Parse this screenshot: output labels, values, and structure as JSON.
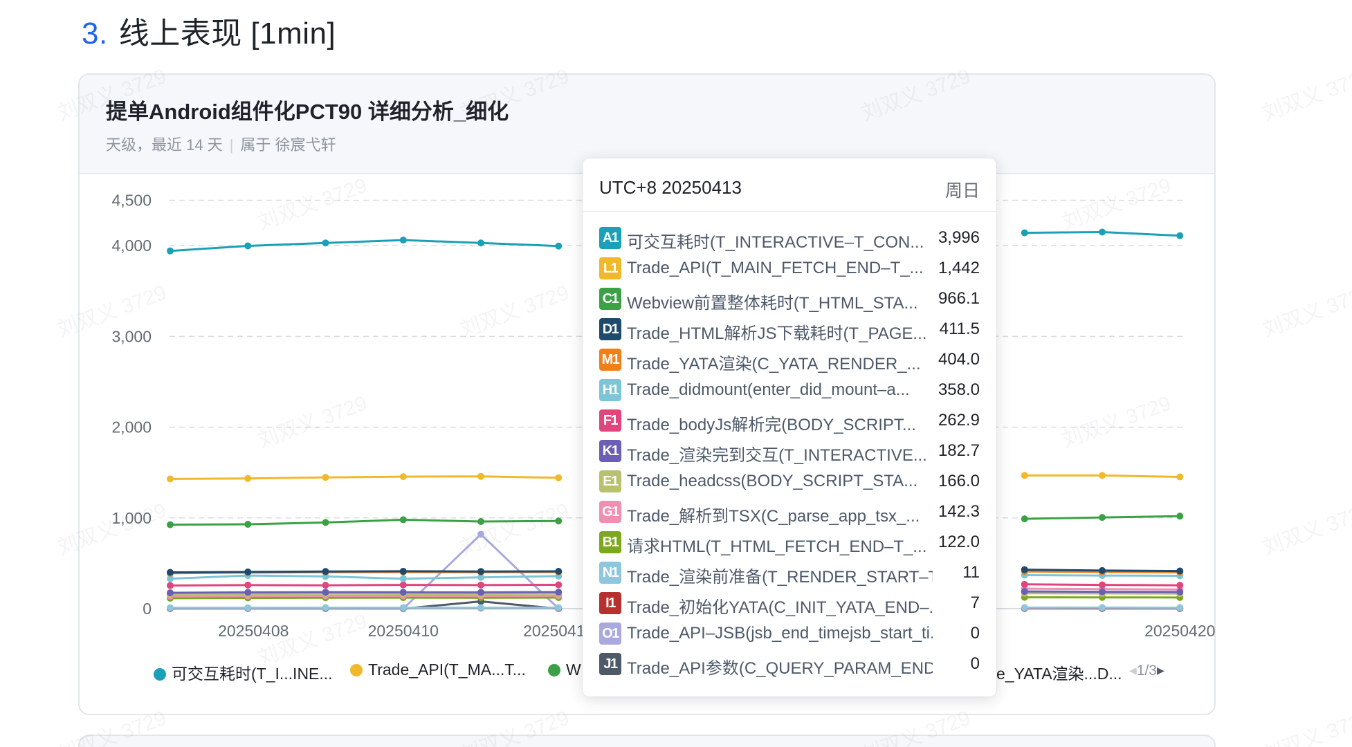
{
  "section": {
    "number": "3.",
    "title": "线上表现 [1min]"
  },
  "card": {
    "title": "提单Android组件化PCT90 详细分析_细化",
    "subtitle_granularity": "天级，最近 14 天",
    "subtitle_owner": "属于 徐宸弋轩"
  },
  "watermark": "刘双义 3729",
  "legend": {
    "visible_items": [
      {
        "label": "可交互耗时(T_I...INE...",
        "color": "#1aa0b8"
      },
      {
        "label": "Trade_API(T_MA...T...",
        "color": "#f2b82c"
      },
      {
        "label": "W",
        "color": "#3aa145"
      },
      {
        "label": "e_YATA渲染...D...",
        "color": "#f07f1a"
      }
    ],
    "page": "1/3"
  },
  "tooltip": {
    "time": "UTC+8 20250413",
    "day": "周日",
    "rows": [
      {
        "badge": "A1",
        "color": "#1aa0b8",
        "name": "可交互耗时(T_INTERACTIVE–T_CON...",
        "value": "3,996"
      },
      {
        "badge": "L1",
        "color": "#f2b82c",
        "name": "Trade_API(T_MAIN_FETCH_END–T_...",
        "value": "1,442"
      },
      {
        "badge": "C1",
        "color": "#3aa145",
        "name": "Webview前置整体耗时(T_HTML_STA...",
        "value": "966.1"
      },
      {
        "badge": "D1",
        "color": "#1e4a6e",
        "name": "Trade_HTML解析JS下载耗时(T_PAGE...",
        "value": "411.5"
      },
      {
        "badge": "M1",
        "color": "#f07f1a",
        "name": "Trade_YATA渲染(C_YATA_RENDER_...",
        "value": "404.0"
      },
      {
        "badge": "H1",
        "color": "#7cc5d6",
        "name": "Trade_didmount(enter_did_mount–a...",
        "value": "358.0"
      },
      {
        "badge": "F1",
        "color": "#e0457b",
        "name": "Trade_bodyJs解析完(BODY_SCRIPT...",
        "value": "262.9"
      },
      {
        "badge": "K1",
        "color": "#6b5fb5",
        "name": "Trade_渲染完到交互(T_INTERACTIVE...",
        "value": "182.7"
      },
      {
        "badge": "E1",
        "color": "#b7c16e",
        "name": "Trade_headcss(BODY_SCRIPT_STA...",
        "value": "166.0"
      },
      {
        "badge": "G1",
        "color": "#f08fb0",
        "name": "Trade_解析到TSX(C_parse_app_tsx_...",
        "value": "142.3"
      },
      {
        "badge": "B1",
        "color": "#7ba81e",
        "name": "请求HTML(T_HTML_FETCH_END–T_...",
        "value": "122.0"
      },
      {
        "badge": "N1",
        "color": "#8ec6dd",
        "name": "Trade_渲染前准备(T_RENDER_START–T...",
        "value": "11"
      },
      {
        "badge": "I1",
        "color": "#b72f2f",
        "name": "Trade_初始化YATA(C_INIT_YATA_END–...",
        "value": "7"
      },
      {
        "badge": "O1",
        "color": "#a9a9e0",
        "name": "Trade_API–JSB(jsb_end_timejsb_start_ti...",
        "value": "0"
      },
      {
        "badge": "J1",
        "color": "#4e5969",
        "name": "Trade_API参数(C_QUERY_PARAM_END–...",
        "value": "0"
      }
    ]
  },
  "chart_data": {
    "type": "line",
    "x": [
      "20250407",
      "20250408",
      "20250409",
      "20250410",
      "20250411",
      "20250412",
      "20250413",
      "20250414",
      "20250415",
      "20250416",
      "20250417",
      "20250418",
      "20250419",
      "20250420"
    ],
    "x_tick_labels": [
      "20250408",
      "20250410",
      "20250412",
      "20250420"
    ],
    "y_ticks": [
      0,
      1000,
      2000,
      3000,
      4000,
      4500
    ],
    "y_tick_labels": [
      "0",
      "1,000",
      "2,000",
      "3,000",
      "4,000",
      "4,500"
    ],
    "ylim": [
      0,
      4500
    ],
    "grid": true,
    "legend_position": "bottom",
    "series": [
      {
        "name": "可交互耗时(T_INTERACTIVE–T_CON...",
        "color": "#1aa0b8",
        "values": [
          3942,
          3998,
          4030,
          4062,
          4030,
          3996,
          null,
          null,
          null,
          null,
          null,
          4142,
          4150,
          4110
        ]
      },
      {
        "name": "Trade_API(T_MAIN_FETCH_END–T_...",
        "color": "#f2b82c",
        "values": [
          1430,
          1435,
          1447,
          1455,
          1458,
          1442,
          null,
          null,
          null,
          null,
          null,
          1468,
          1468,
          1452
        ]
      },
      {
        "name": "Webview前置整体耗时(T_HTML_STA...",
        "color": "#3aa145",
        "values": [
          925,
          930,
          950,
          980,
          960,
          966.1,
          null,
          null,
          null,
          null,
          null,
          990,
          1005,
          1020
        ]
      },
      {
        "name": "Trade_HTML解析JS下载耗时(T_PAGE...",
        "color": "#1e4a6e",
        "values": [
          400,
          405,
          410,
          412,
          410,
          411.5,
          null,
          null,
          null,
          null,
          null,
          430,
          420,
          415
        ]
      },
      {
        "name": "Trade_YATA渲染(C_YATA_RENDER_...",
        "color": "#f07f1a",
        "values": [
          390,
          398,
          402,
          403,
          402,
          404,
          null,
          null,
          null,
          null,
          null,
          410,
          405,
          402
        ]
      },
      {
        "name": "Trade_didmount(enter_did_mount–a...",
        "color": "#7cc5d6",
        "values": [
          330,
          365,
          355,
          330,
          345,
          358,
          null,
          null,
          null,
          null,
          null,
          370,
          365,
          362
        ]
      },
      {
        "name": "Trade_bodyJs解析完(BODY_SCRIPT...",
        "color": "#e0457b",
        "values": [
          255,
          260,
          258,
          262,
          260,
          262.9,
          null,
          null,
          null,
          null,
          null,
          268,
          262,
          258
        ]
      },
      {
        "name": "Trade_渲染完到交互(T_INTERACTIVE...",
        "color": "#6b5fb5",
        "values": [
          175,
          180,
          182,
          181,
          180,
          182.7,
          null,
          null,
          null,
          null,
          null,
          190,
          186,
          184
        ]
      },
      {
        "name": "Trade_headcss(BODY_SCRIPT_STA...",
        "color": "#b7c16e",
        "values": [
          160,
          163,
          165,
          164,
          164,
          166,
          null,
          null,
          null,
          null,
          null,
          170,
          168,
          166
        ]
      },
      {
        "name": "Trade_解析到TSX(C_parse_app_tsx_...",
        "color": "#f08fb0",
        "values": [
          138,
          140,
          141,
          142,
          141,
          142.3,
          null,
          null,
          null,
          null,
          null,
          220,
          215,
          212
        ]
      },
      {
        "name": "请求HTML(T_HTML_FETCH_END–T_...",
        "color": "#7ba81e",
        "values": [
          115,
          118,
          120,
          121,
          120,
          122,
          null,
          null,
          null,
          null,
          null,
          125,
          124,
          123
        ]
      },
      {
        "name": "Trade_渲染前准备(T_RENDER_START–T...",
        "color": "#8ec6dd",
        "values": [
          10,
          10,
          11,
          11,
          11,
          11,
          null,
          null,
          null,
          null,
          null,
          12,
          12,
          11
        ]
      },
      {
        "name": "Trade_初始化YATA(C_INIT_YATA_END–...",
        "color": "#b72f2f",
        "values": [
          6,
          7,
          7,
          7,
          7,
          7,
          null,
          null,
          null,
          null,
          null,
          8,
          7,
          7
        ]
      },
      {
        "name": "Trade_API–JSB(jsb_end_timejsb_start_ti...",
        "color": "#a9a9e0",
        "values": [
          0,
          0,
          0,
          0,
          820,
          0,
          null,
          null,
          null,
          null,
          null,
          0,
          0,
          0
        ]
      },
      {
        "name": "Trade_API参数(C_QUERY_PARAM_END–...",
        "color": "#4e5969",
        "values": [
          0,
          0,
          0,
          0,
          80,
          0,
          null,
          null,
          null,
          null,
          null,
          0,
          0,
          0
        ]
      }
    ]
  }
}
